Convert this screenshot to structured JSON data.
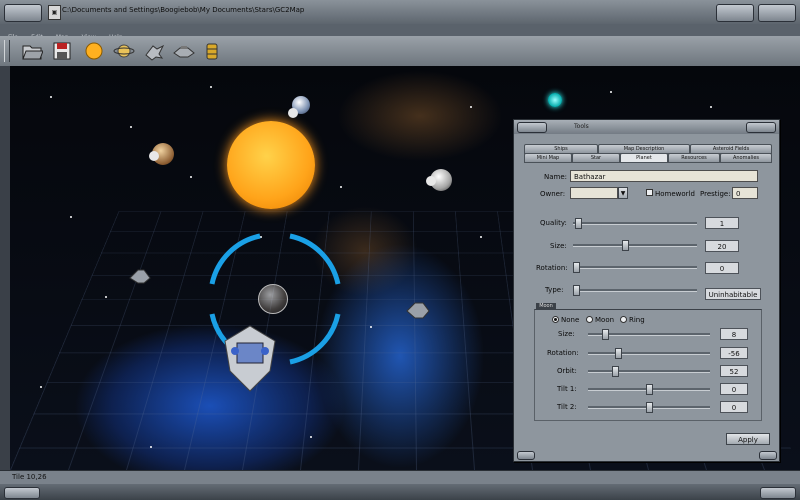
{
  "window": {
    "title": "C:\\Documents and Settings\\Boogiebob\\My Documents\\Stars\\GC2Map",
    "menu": [
      "File",
      "Edit",
      "Map",
      "View",
      "Help"
    ]
  },
  "toolbar": {
    "icons": [
      "open-folder-icon",
      "save-icon",
      "sun-icon",
      "planet-icon",
      "ship-icon",
      "station-icon",
      "resource-barrel-icon"
    ]
  },
  "status": {
    "text": "Tile 10,26"
  },
  "tools_panel": {
    "title": "Tools",
    "tabs_row1": [
      "Ships",
      "Map Description",
      "Asteroid Fields"
    ],
    "tabs_row2": [
      "Mini Map",
      "Star",
      "Planet",
      "Resources",
      "Anomalies"
    ],
    "active_tab": "Planet",
    "name_label": "Name:",
    "name_value": "Bathazar",
    "owner_label": "Owner:",
    "owner_value": "",
    "homeworld_label": "Homeworld",
    "homeworld_checked": false,
    "prestige_label": "Prestige:",
    "prestige_value": "0",
    "quality_label": "Quality:",
    "quality_value": "1",
    "size_label": "Size:",
    "size_value": "20",
    "rotation_label": "Rotation:",
    "rotation_value": "0",
    "type_label": "Type:",
    "type_value": "Uninhabitable",
    "moon": {
      "group_label": "Moon",
      "options": [
        "None",
        "Moon",
        "Ring"
      ],
      "selected": "None",
      "size_label": "Size:",
      "size_value": "8",
      "rotation_label": "Rotation:",
      "rotation_value": "-56",
      "orbit_label": "Orbit:",
      "orbit_value": "52",
      "tilt1_label": "Tilt 1:",
      "tilt1_value": "0",
      "tilt2_label": "Tilt 2:",
      "tilt2_value": "0"
    },
    "apply_label": "Apply"
  },
  "colors": {
    "sun": "#ffa41a",
    "selection_ring": "#1aa0e6",
    "nebula": "#1f5ad0",
    "panel": "#8e969e"
  }
}
